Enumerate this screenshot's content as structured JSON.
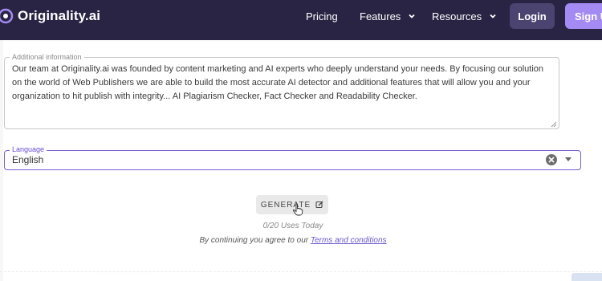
{
  "brand": {
    "name": "Originality.ai",
    "icon": "originality-logo-icon"
  },
  "nav": {
    "pricing": "Pricing",
    "features": "Features",
    "resources": "Resources",
    "login": "Login",
    "signup": "Sign Up",
    "chevron_icon": "chevron-down-icon"
  },
  "additional_info": {
    "label": "Additional information",
    "value": "Our team at Originality.ai was founded by content marketing and AI experts who deeply understand your needs. By focusing our solution on the world of Web Publishers we are able to build the most accurate AI detector and additional features that will allow you and your organization to hit publish with integrity... AI Plagiarism Checker, Fact Checker and Readability Checker."
  },
  "language": {
    "label": "Language",
    "selected": "English",
    "clear_icon": "clear-icon",
    "dropdown_icon": "caret-down-icon"
  },
  "generate": {
    "label": "GENERATE",
    "icon": "edit-icon",
    "uses": "0/20 Uses Today",
    "terms_prefix": "By continuing you agree to our ",
    "terms_link": "Terms and conditions"
  },
  "colors": {
    "header_bg": "#2a2444",
    "login_bg": "#4b4470",
    "signup_bg": "#a48bf3",
    "focus_border": "#7b5cd6"
  }
}
